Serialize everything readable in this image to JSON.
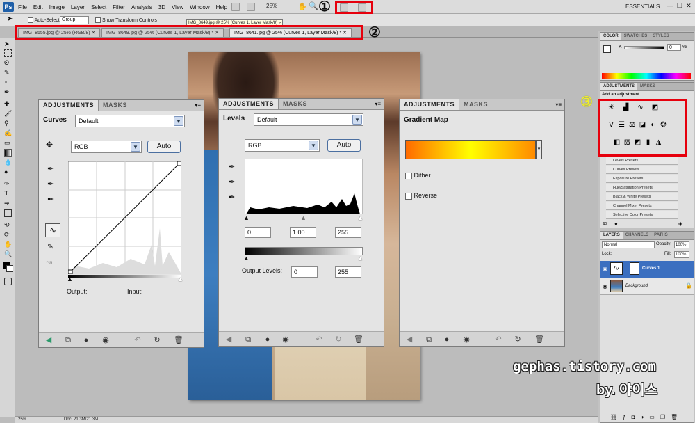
{
  "app": {
    "logo": "Ps"
  },
  "menu": [
    "File",
    "Edit",
    "Image",
    "Layer",
    "Select",
    "Filter",
    "Analysis",
    "3D",
    "View",
    "Window",
    "Help"
  ],
  "toolbar": {
    "zoom": "25%",
    "workspace": "ESSENTIALS"
  },
  "options": {
    "auto_select_label": "Auto-Select:",
    "auto_select_value": "Group",
    "transform_label": "Show Transform Controls",
    "tooltip": "IMG_8649.jpg @ 25% (Curves 1, Layer Mask/8) »"
  },
  "doc_tabs": [
    "IMG_8655.jpg @ 25% (RGB/8)",
    "IMG_8649.jpg @ 25% (Curves 1, Layer Mask/8) *",
    "IMG_8641.jpg @ 25% (Curves 1, Layer Mask/8) *"
  ],
  "annotations": {
    "one": "①",
    "two": "②",
    "three": "③"
  },
  "panel_tabs": {
    "adjustments": "ADJUSTMENTS",
    "masks": "MASKS"
  },
  "curves": {
    "title": "Curves",
    "preset": "Default",
    "channel": "RGB",
    "auto": "Auto",
    "output": "Output:",
    "input": "Input:"
  },
  "levels": {
    "title": "Levels",
    "preset": "Default",
    "channel": "RGB",
    "auto": "Auto",
    "in_black": "0",
    "in_gamma": "1.00",
    "in_white": "255",
    "output_label": "Output Levels:",
    "out_black": "0",
    "out_white": "255"
  },
  "gradient_map": {
    "title": "Gradient Map",
    "dither": "Dither",
    "reverse": "Reverse"
  },
  "right": {
    "color_tabs": [
      "COLOR",
      "SWATCHES",
      "STYLES"
    ],
    "k_label": "K",
    "k_value": "0",
    "k_unit": "%",
    "adj_tabs": [
      "ADJUSTMENTS",
      "MASKS"
    ],
    "add_adjustment": "Add an adjustment",
    "presets": [
      "Levels Presets",
      "Curves Presets",
      "Exposure Presets",
      "Hue/Saturation Presets",
      "Black & White Presets",
      "Channel Mixer Presets",
      "Selective Color Presets"
    ],
    "layer_tabs": [
      "LAYERS",
      "CHANNELS",
      "PATHS"
    ],
    "blend": "Normal",
    "opacity_label": "Opacity:",
    "opacity": "100%",
    "lock_label": "Lock:",
    "fill_label": "Fill:",
    "fill": "100%",
    "layers": [
      "Curves 1",
      "Background"
    ]
  },
  "status": {
    "zoom": "25%",
    "doc": "Doc: 21.3M/21.3M"
  },
  "watermark": {
    "line1": "gephas.tistory.com",
    "line2": "by. 야이스"
  }
}
